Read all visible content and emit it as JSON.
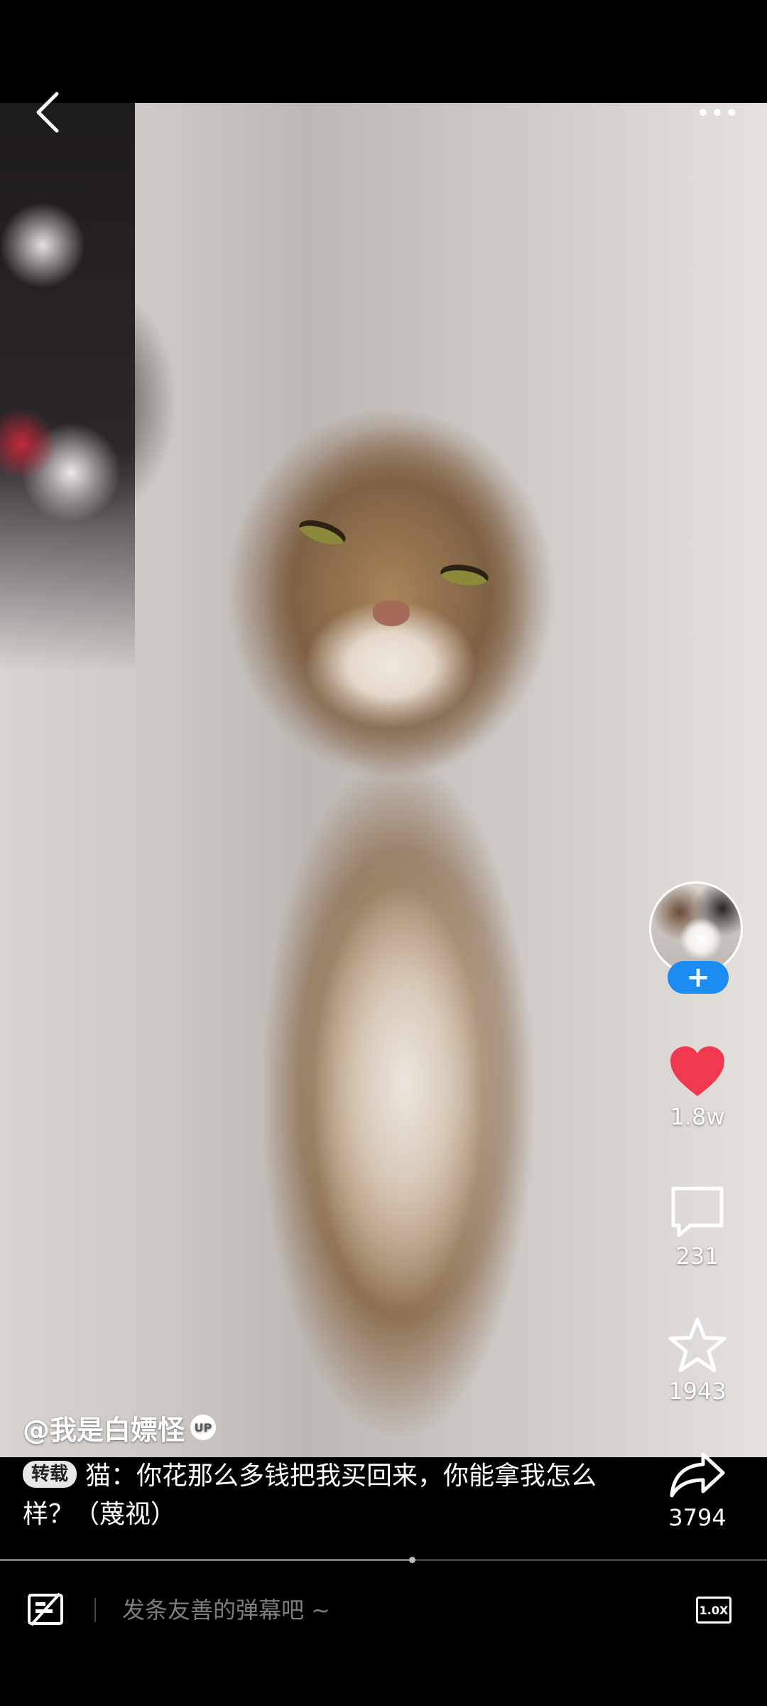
{
  "top_bar": {
    "back_icon": "chevron-left-icon",
    "more_icon": "more-dots-icon"
  },
  "video": {
    "subject": "cat"
  },
  "uploader": {
    "handle": "@我是白嫖怪",
    "badge": "UP"
  },
  "caption": {
    "tag": "转载",
    "text": "猫：你花那么多钱把我买回来，你能拿我怎么样？（蔑视）"
  },
  "rail": {
    "follow_label": "+",
    "like": {
      "count": "1.8w",
      "color": "#f0394f"
    },
    "comment": {
      "count": "231"
    },
    "favorite": {
      "count": "1943"
    },
    "share": {
      "count": "3794"
    }
  },
  "progress": {
    "fraction": 0.537
  },
  "bottom_bar": {
    "danmaku_placeholder": "发条友善的弹幕吧 ~",
    "speed_label": "1.0X"
  },
  "colors": {
    "accent": "#1c8cf0",
    "like": "#f0394f"
  }
}
